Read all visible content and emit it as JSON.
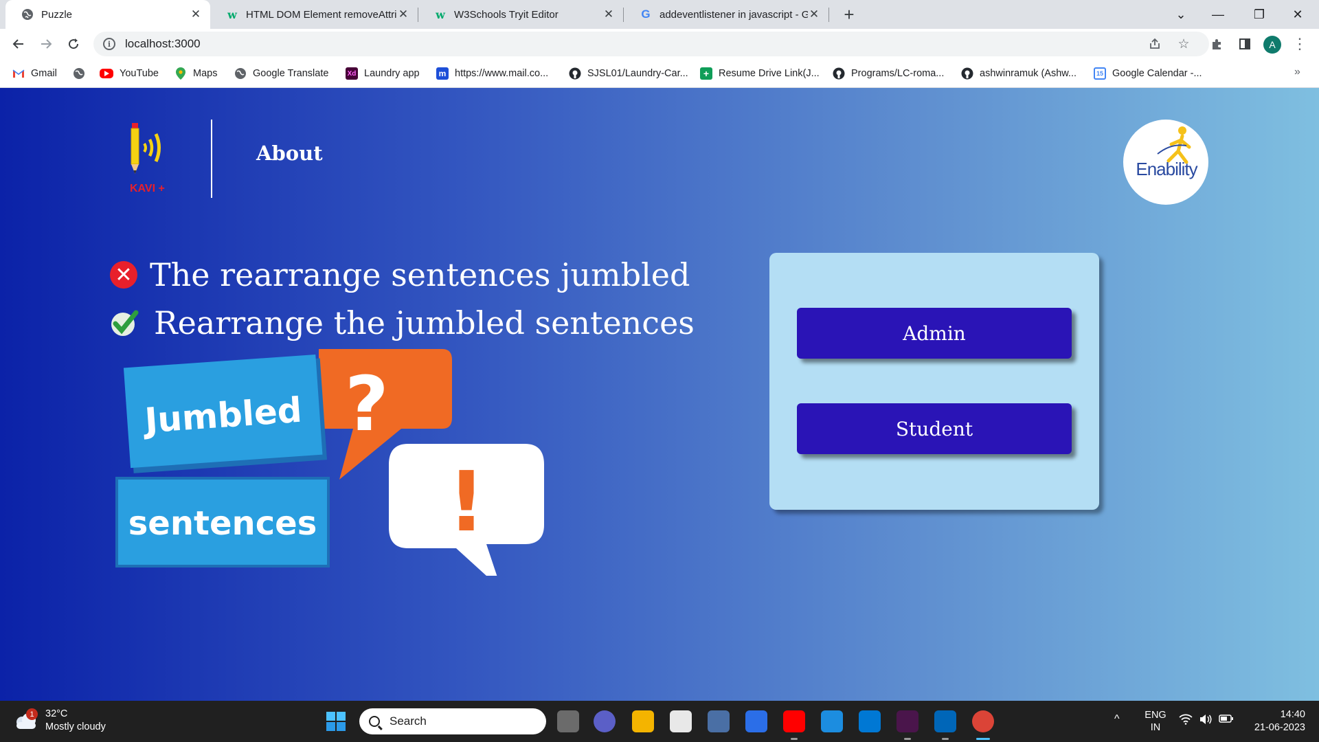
{
  "browser": {
    "tabs": [
      {
        "title": "Puzzle",
        "favicon": "globe-icon",
        "active": true
      },
      {
        "title": "HTML DOM Element removeAttri",
        "favicon": "w3schools-icon",
        "active": false
      },
      {
        "title": "W3Schools Tryit Editor",
        "favicon": "w3schools-icon",
        "active": false
      },
      {
        "title": "addeventlistener in javascript - G",
        "favicon": "google-icon",
        "active": false
      }
    ],
    "new_tab_glyph": "+",
    "window_controls": {
      "dropdown": "⌄",
      "minimize": "—",
      "restore": "❐",
      "close": "✕"
    },
    "url": "localhost:3000",
    "profile_initial": "A",
    "bookmarks": [
      {
        "label": "Gmail",
        "icon": "gmail-icon"
      },
      {
        "label": "",
        "icon": "globe-icon"
      },
      {
        "label": "YouTube",
        "icon": "youtube-icon"
      },
      {
        "label": "Maps",
        "icon": "maps-icon"
      },
      {
        "label": "Google Translate",
        "icon": "globe-icon"
      },
      {
        "label": "Laundry app",
        "icon": "adobe-xd-icon"
      },
      {
        "label": "https://www.mail.co...",
        "icon": "mail-com-icon"
      },
      {
        "label": "SJSL01/Laundry-Car...",
        "icon": "github-icon"
      },
      {
        "label": "Resume Drive Link(J...",
        "icon": "sheets-icon"
      },
      {
        "label": "Programs/LC-roma...",
        "icon": "github-icon"
      },
      {
        "label": "ashwinramuk (Ashw...",
        "icon": "github-icon"
      },
      {
        "label": "Google Calendar -...",
        "icon": "calendar-icon"
      }
    ],
    "bookmarks_more": "»"
  },
  "app": {
    "logo_text": "KAVI +",
    "nav_about": "About",
    "partner_logo_text": "Enability",
    "wrong_line": "The rearrange sentences jumbled",
    "right_line": "Rearrange the jumbled sentences",
    "graphic": {
      "word1": "Jumbled",
      "word2": "sentences",
      "question": "?",
      "exclaim": "!"
    },
    "roles": {
      "admin": "Admin",
      "student": "Student"
    },
    "colors": {
      "button": "#2a14b6",
      "card": "#b4def4",
      "wrong": "#e8202b",
      "right": "#2e9e3e",
      "orange": "#f06a24",
      "blue_box": "#2a9fe0"
    }
  },
  "taskbar": {
    "weather": {
      "temp": "32°C",
      "condition": "Mostly cloudy",
      "badge": "1"
    },
    "search_placeholder": "Search",
    "tray": {
      "lang1": "ENG",
      "lang2": "IN",
      "expand": "^"
    },
    "clock": {
      "time": "14:40",
      "date": "21-06-2023"
    }
  }
}
